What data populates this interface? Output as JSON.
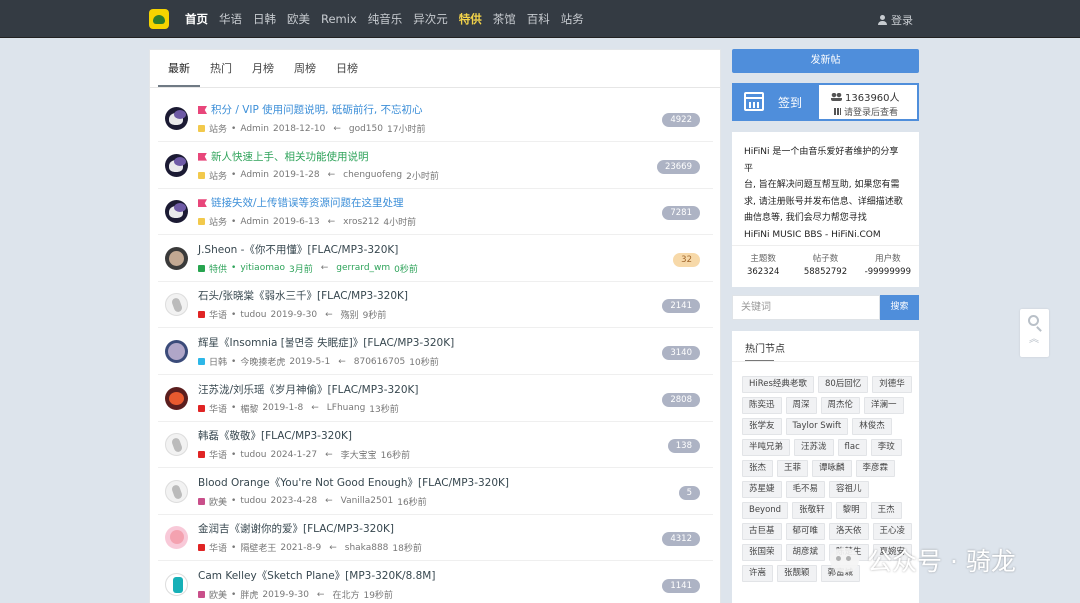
{
  "nav": {
    "items": [
      {
        "label": "首页",
        "style": "active"
      },
      {
        "label": "华语",
        "style": ""
      },
      {
        "label": "日韩",
        "style": ""
      },
      {
        "label": "欧美",
        "style": ""
      },
      {
        "label": "Remix",
        "style": ""
      },
      {
        "label": "纯音乐",
        "style": ""
      },
      {
        "label": "异次元",
        "style": ""
      },
      {
        "label": "特供",
        "style": "special"
      },
      {
        "label": "茶馆",
        "style": ""
      },
      {
        "label": "百科",
        "style": ""
      },
      {
        "label": "站务",
        "style": ""
      }
    ],
    "login": "登录"
  },
  "tabs": [
    "最新",
    "热门",
    "月榜",
    "周榜",
    "日榜"
  ],
  "threads": [
    {
      "title": "积分 / VIP 使用问题说明, 砥砺前行, 不忘初心",
      "pinned": true,
      "title_color": "blue",
      "forum": "站务",
      "forum_color": "#f2c94c",
      "author": "Admin",
      "date": "2018-12-10",
      "last_user": "god150",
      "last_time": "17小时前",
      "count": "4922",
      "badge": "gray",
      "avatar": "dark"
    },
    {
      "title": "新人快速上手、相关功能使用说明",
      "pinned": true,
      "title_color": "green",
      "forum": "站务",
      "forum_color": "#f2c94c",
      "author": "Admin",
      "date": "2019-1-28",
      "last_user": "chenguofeng",
      "last_time": "2小时前",
      "count": "23669",
      "badge": "gray",
      "avatar": "dark"
    },
    {
      "title": "链接失效/上传错误等资源问题在这里处理",
      "pinned": true,
      "title_color": "blue",
      "forum": "站务",
      "forum_color": "#f2c94c",
      "author": "Admin",
      "date": "2019-6-13",
      "last_user": "xros212",
      "last_time": "4小时前",
      "count": "7281",
      "badge": "gray",
      "avatar": "dark"
    },
    {
      "title": "J.Sheon -《你不用懂》[FLAC/MP3-320K]",
      "pinned": false,
      "title_color": "",
      "forum": "特供",
      "forum_color": "#27a44f",
      "author": "yitiaomao",
      "date": "3月前",
      "last_user": "gerrard_wm",
      "last_time": "0秒前",
      "count": "32",
      "badge": "orange",
      "avatar": "rock",
      "meta_color": "green"
    },
    {
      "title": "石头/张晓棠《弱水三千》[FLAC/MP3-320K]",
      "pinned": false,
      "title_color": "",
      "forum": "华语",
      "forum_color": "#e02424",
      "author": "tudou",
      "date": "2019-9-30",
      "last_user": "殇别",
      "last_time": "9秒前",
      "count": "2141",
      "badge": "gray",
      "avatar": "light"
    },
    {
      "title": "辉星《Insomnia [불면증 失眠症]》[FLAC/MP3-320K]",
      "pinned": false,
      "title_color": "",
      "forum": "日韩",
      "forum_color": "#2db7e8",
      "author": "今晚揍老虎",
      "date": "2019-5-1",
      "last_user": "870616705",
      "last_time": "10秒前",
      "count": "3140",
      "badge": "gray",
      "avatar": "blue"
    },
    {
      "title": "汪苏泷/刘乐瑶《岁月神偷》[FLAC/MP3-320K]",
      "pinned": false,
      "title_color": "",
      "forum": "华语",
      "forum_color": "#e02424",
      "author": "楣黎",
      "date": "2019-1-8",
      "last_user": "LFhuang",
      "last_time": "13秒前",
      "count": "2808",
      "badge": "gray",
      "avatar": "red"
    },
    {
      "title": "韩磊《敬敬》[FLAC/MP3-320K]",
      "pinned": false,
      "title_color": "",
      "forum": "华语",
      "forum_color": "#e02424",
      "author": "tudou",
      "date": "2024-1-27",
      "last_user": "李大宝宝",
      "last_time": "16秒前",
      "count": "138",
      "badge": "gray",
      "avatar": "light"
    },
    {
      "title": "Blood Orange《You're Not Good Enough》[FLAC/MP3-320K]",
      "pinned": false,
      "title_color": "",
      "forum": "欧美",
      "forum_color": "#c94f8a",
      "author": "tudou",
      "date": "2023-4-28",
      "last_user": "Vanilla2501",
      "last_time": "16秒前",
      "count": "5",
      "badge": "gray",
      "avatar": "light"
    },
    {
      "title": "金润吉《谢谢你的爱》[FLAC/MP3-320K]",
      "pinned": false,
      "title_color": "",
      "forum": "华语",
      "forum_color": "#e02424",
      "author": "隔壁老王",
      "date": "2021-8-9",
      "last_user": "shaka888",
      "last_time": "18秒前",
      "count": "4312",
      "badge": "gray",
      "avatar": "pink"
    },
    {
      "title": "Cam Kelley《Sketch Plane》[MP3-320K/8.8M]",
      "pinned": false,
      "title_color": "",
      "forum": "欧美",
      "forum_color": "#c94f8a",
      "author": "胖虎",
      "date": "2019-9-30",
      "last_user": "在北方",
      "last_time": "19秒前",
      "count": "1141",
      "badge": "gray",
      "avatar": "teal"
    }
  ],
  "sidebar": {
    "new_post": "发新帖",
    "sign_label": "签到",
    "sign_count": "1363960人",
    "sign_hint": "请登录后查看",
    "intro_lines": [
      "HiFiNi 是一个由音乐爱好者维护的分享平",
      "台, 旨在解决问题互帮互助, 如果您有需",
      "求, 请注册账号并发布信息、详细描述歌",
      "曲信息等, 我们会尽力帮您寻找",
      "HiFiNi MUSIC BBS - HiFiNi.COM"
    ],
    "stats": [
      {
        "label": "主题数",
        "value": "362324"
      },
      {
        "label": "帖子数",
        "value": "58852792"
      },
      {
        "label": "用户数",
        "value": "-99999999"
      }
    ],
    "search_placeholder": "关键词",
    "search_button": "搜索",
    "hot_title": "热门节点",
    "tags": [
      "HiRes经典老歌",
      "80后回忆",
      "刘德华",
      "陈奕迅",
      "周深",
      "周杰伦",
      "洋澜一",
      "张学友",
      "Taylor Swift",
      "林俊杰",
      "半吨兄弟",
      "汪苏泷",
      "flac",
      "李玟",
      "张杰",
      "王菲",
      "谭咏麟",
      "李彦霖",
      "苏星婕",
      "毛不易",
      "容祖儿",
      "Beyond",
      "张敬轩",
      "黎明",
      "王杰",
      "古巨基",
      "郁可唯",
      "洛天依",
      "王心凌",
      "张国荣",
      "胡彦斌",
      "陈楚生",
      "夏婉安",
      "许嵩",
      "张靓颖",
      "郭富城"
    ]
  },
  "watermark": "公众号 · 骑龙",
  "float_up": "︽"
}
